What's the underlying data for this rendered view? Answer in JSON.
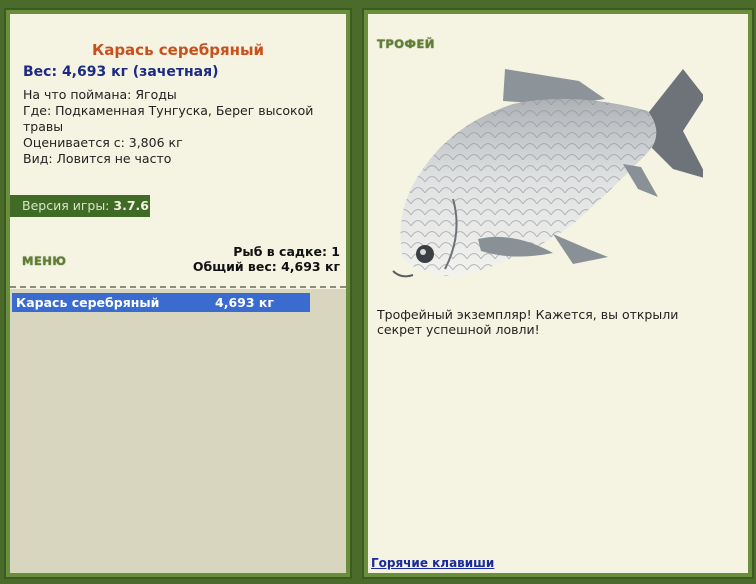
{
  "fish": {
    "name": "Карась серебряный",
    "weight_line": "Вес: 4,693 кг (зачетная)",
    "bait": "На что поймана: Ягоды",
    "location": "Где: Подкаменная Тунгуска, Берег высокой травы",
    "value": "Оценивается с: 3,806 кг",
    "rarity": "Вид: Ловится не часто"
  },
  "version": {
    "label": "Версия игры:",
    "number": "3.7.6"
  },
  "menu_label": "МЕНЮ",
  "keepnet": {
    "count_line": "Рыб в садке: 1",
    "total_line": "Общий вес: 4,693 кг"
  },
  "catch_list": [
    {
      "name": "Карась серебряный",
      "weight": "4,693 кг"
    }
  ],
  "trophy": {
    "heading": "ТРОФЕЙ",
    "message": "Трофейный экземпляр! Кажется, вы открыли секрет успешной ловли!"
  },
  "hotkeys_link": "Горячие клавиши",
  "colors": {
    "background": "#4a6b2a",
    "panel": "#f5f3e2",
    "title_orange": "#c8501b",
    "weight_blue": "#1c2a82",
    "selection": "#3a6ccf",
    "list_bg": "#d9d6c0"
  }
}
